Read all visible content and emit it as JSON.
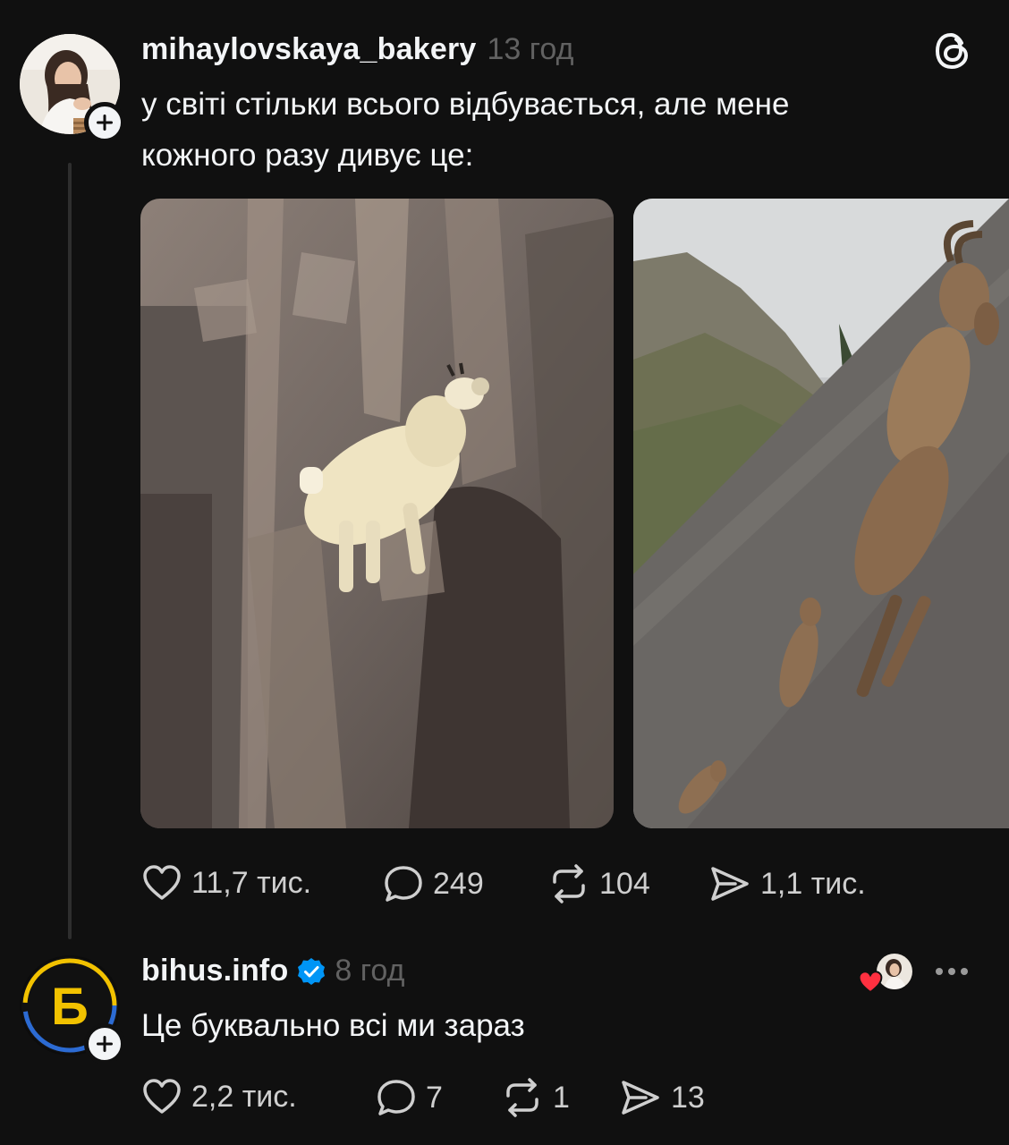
{
  "post": {
    "username": "mihaylovskaya_bakery",
    "time": "13 год",
    "text_line1": "у світі стільки всього відбувається, але мене",
    "text_line2": "кожного разу дивує це:",
    "avatar_icon": "user-portrait-avatar",
    "follow_icon": "plus-icon",
    "app_icon": "threads-logo-icon",
    "images": [
      {
        "description_icon": "mountain-goat-photo"
      },
      {
        "description_icon": "ibex-on-dam-photo"
      }
    ],
    "actions": {
      "likes": "11,7 тис.",
      "replies": "249",
      "reposts": "104",
      "shares": "1,1 тис."
    }
  },
  "reply": {
    "username": "bihus.info",
    "verified_icon": "verified-badge-icon",
    "time": "8 год",
    "text": "Це буквально всі ми зараз",
    "avatar_letter": "Б",
    "liked_by_author_icon": "heart-with-author-avatar-icon",
    "more_icon": "more-dots-icon",
    "actions": {
      "likes": "2,2 тис.",
      "replies": "7",
      "reposts": "1",
      "shares": "13"
    }
  },
  "colors": {
    "background": "#101010",
    "text": "#f3f5f7",
    "muted": "#616161",
    "verified": "#0095f6",
    "heart": "#ff3040",
    "bihus_yellow": "#f2c200",
    "bihus_blue": "#2c6bd3"
  }
}
